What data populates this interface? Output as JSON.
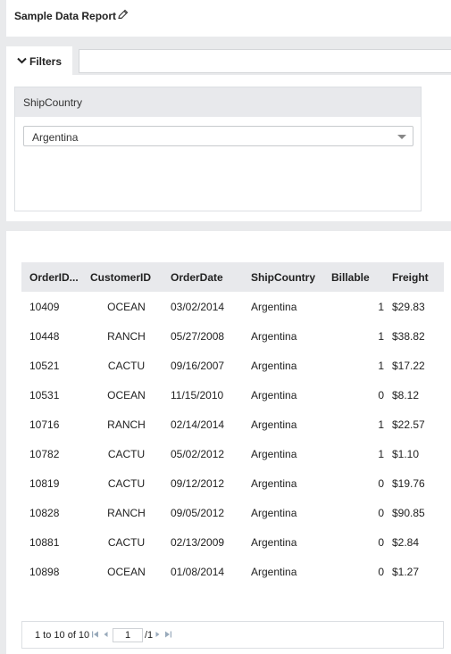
{
  "report": {
    "title": "Sample Data Report"
  },
  "filters": {
    "tab_label": "Filters",
    "field_label": "ShipCountry",
    "selected_value": "Argentina"
  },
  "grid": {
    "columns": [
      "OrderID...",
      "CustomerID",
      "OrderDate",
      "ShipCountry",
      "Billable",
      "Freight"
    ],
    "rows": [
      [
        "10409",
        "OCEAN",
        "03/02/2014",
        "Argentina",
        "1",
        "$29.83"
      ],
      [
        "10448",
        "RANCH",
        "05/27/2008",
        "Argentina",
        "1",
        "$38.82"
      ],
      [
        "10521",
        "CACTU",
        "09/16/2007",
        "Argentina",
        "1",
        "$17.22"
      ],
      [
        "10531",
        "OCEAN",
        "11/15/2010",
        "Argentina",
        "0",
        "$8.12"
      ],
      [
        "10716",
        "RANCH",
        "02/14/2014",
        "Argentina",
        "1",
        "$22.57"
      ],
      [
        "10782",
        "CACTU",
        "05/02/2012",
        "Argentina",
        "1",
        "$1.10"
      ],
      [
        "10819",
        "CACTU",
        "09/12/2012",
        "Argentina",
        "0",
        "$19.76"
      ],
      [
        "10828",
        "RANCH",
        "09/05/2012",
        "Argentina",
        "0",
        "$90.85"
      ],
      [
        "10881",
        "CACTU",
        "02/13/2009",
        "Argentina",
        "0",
        "$2.84"
      ],
      [
        "10898",
        "OCEAN",
        "01/08/2014",
        "Argentina",
        "0",
        "$1.27"
      ]
    ]
  },
  "pager": {
    "info": "1 to 10 of 10",
    "current_page": "1",
    "total_pages": "/1",
    "icons": [
      "first-page-icon",
      "prev-page-icon",
      "next-page-icon",
      "last-page-icon"
    ]
  },
  "colors": {
    "background": "#e9eaec",
    "header_bg": "#e8e9ec",
    "panel_bg": "#ffffff"
  }
}
